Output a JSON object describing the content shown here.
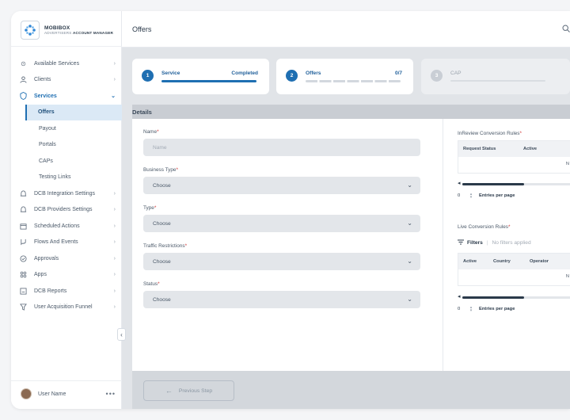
{
  "brand": {
    "name": "MOBIBOX",
    "sub_prefix": "ADVERTISERS",
    "sub_strong": "ACCOUNT MANAGER"
  },
  "sidebar": {
    "items": [
      {
        "label": "Available Services",
        "icon": "target-icon"
      },
      {
        "label": "Clients",
        "icon": "user-icon"
      },
      {
        "label": "Services",
        "icon": "shield-icon"
      },
      {
        "label": "Offers",
        "icon": ""
      },
      {
        "label": "Payout",
        "icon": ""
      },
      {
        "label": "Portals",
        "icon": ""
      },
      {
        "label": "CAPs",
        "icon": ""
      },
      {
        "label": "Testing Links",
        "icon": ""
      },
      {
        "label": "DCB Integration Settings",
        "icon": "bell-icon"
      },
      {
        "label": "DCB Providers Settings",
        "icon": "bell-icon"
      },
      {
        "label": "Scheduled Actions",
        "icon": "calendar-icon"
      },
      {
        "label": "Flows And Events",
        "icon": "flow-icon"
      },
      {
        "label": "Approvals",
        "icon": "check-circle-icon"
      },
      {
        "label": "Apps",
        "icon": "grid-icon"
      },
      {
        "label": "DCB Reports",
        "icon": "report-icon"
      },
      {
        "label": "User Acquisition Funnel",
        "icon": "funnel-icon"
      }
    ],
    "user_name": "User Name"
  },
  "header": {
    "title": "Offers"
  },
  "steps": [
    {
      "num": "1",
      "title": "Service",
      "status": "Completed"
    },
    {
      "num": "2",
      "title": "Offers",
      "status": "0/7"
    },
    {
      "num": "3",
      "title": "CAP",
      "status": ""
    }
  ],
  "details": {
    "heading": "Details"
  },
  "form": {
    "name_label": "Name",
    "name_placeholder": "Name",
    "business_type_label": "Business Type",
    "type_label": "Type",
    "traffic_label": "Traffic Restrictions",
    "status_label": "Status",
    "choose": "Choose",
    "required_mark": "*"
  },
  "rules": {
    "inreview_label": "InReview Conversion Rules",
    "inreview_headers": [
      "Request Status",
      "Active"
    ],
    "no_data": "N",
    "entries_count": "0",
    "entries_label": "Entries per page",
    "live_label": "Live Conversion Rules",
    "filters_label": "Filters",
    "filters_none": "No filters applied",
    "live_headers": [
      "Active",
      "Country",
      "Operator"
    ]
  },
  "footer": {
    "prev_label": "Previous Step"
  },
  "colors": {
    "accent": "#1f6fb2",
    "required": "#d13b3b"
  }
}
